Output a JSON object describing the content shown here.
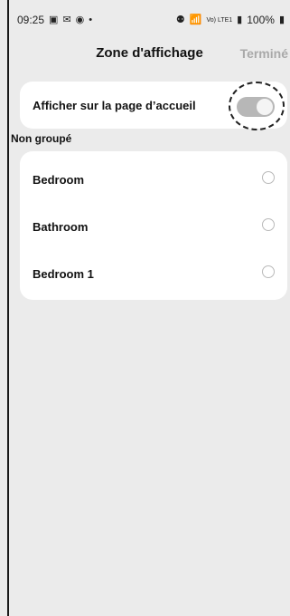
{
  "status_bar": {
    "time": "09:25",
    "left_icons": [
      "image-icon",
      "mail-icon",
      "record-icon",
      "dot-icon"
    ],
    "right_icons": [
      "bug-icon",
      "wifi-icon",
      "volte-icon",
      "signal-icon"
    ],
    "volte_text": "Vo) LTE1",
    "battery_text": "100%"
  },
  "header": {
    "title": "Zone d'affichage",
    "done_label": "Terminé"
  },
  "toggle_card": {
    "label": "Afficher sur la page d’accueil",
    "state": "on"
  },
  "section": {
    "label": "Non groupé"
  },
  "rooms": [
    {
      "name": "Bedroom"
    },
    {
      "name": "Bathroom"
    },
    {
      "name": "Bedroom 1"
    }
  ]
}
